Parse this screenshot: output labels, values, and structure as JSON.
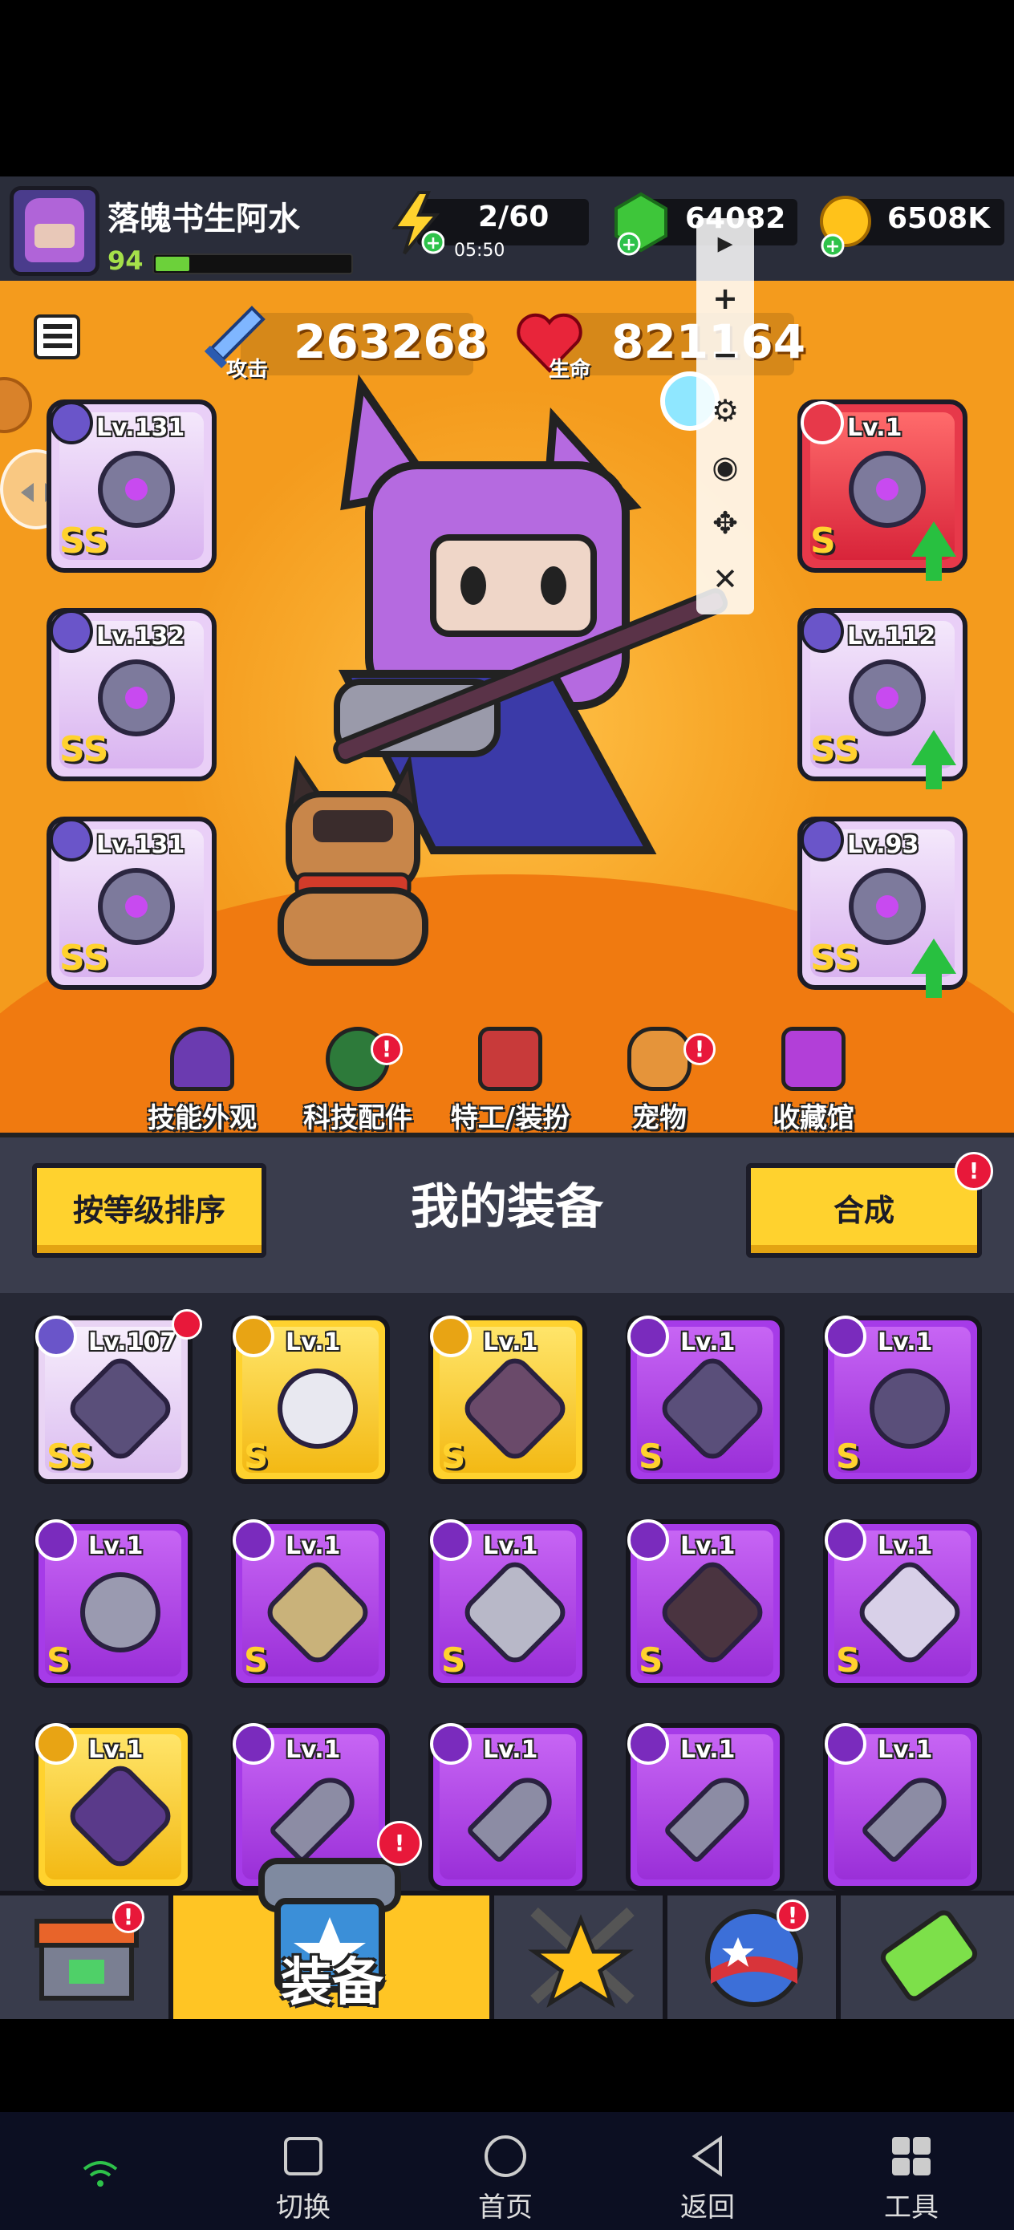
{
  "player": {
    "name": "落魄书生阿水",
    "level": "94"
  },
  "resources": {
    "energy": "2/60",
    "energy_timer": "05:50",
    "gems": "64082",
    "coins": "6508K"
  },
  "stats": {
    "attack_value": "263268",
    "attack_label": "攻击",
    "hp_value": "821164",
    "hp_label": "生命"
  },
  "equipped": {
    "left": [
      {
        "level": "Lv.131",
        "grade": "SS"
      },
      {
        "level": "Lv.132",
        "grade": "SS"
      },
      {
        "level": "Lv.131",
        "grade": "SS"
      }
    ],
    "right": [
      {
        "level": "Lv.1",
        "grade": "S"
      },
      {
        "level": "Lv.112",
        "grade": "SS"
      },
      {
        "level": "Lv.93",
        "grade": "SS"
      }
    ]
  },
  "stage_nav": [
    {
      "label": "技能外观"
    },
    {
      "label": "科技配件",
      "badge": "!"
    },
    {
      "label": "特工/装扮"
    },
    {
      "label": "宠物",
      "badge": "!"
    },
    {
      "label": "收藏馆"
    }
  ],
  "equipment_panel": {
    "sort_button": "按等级排序",
    "title": "我的装备",
    "merge_button": "合成",
    "merge_badge": "!"
  },
  "inventory": [
    {
      "level": "Lv.107",
      "grade": "SS",
      "rarity": "white"
    },
    {
      "level": "Lv.1",
      "grade": "S",
      "rarity": "gold"
    },
    {
      "level": "Lv.1",
      "grade": "S",
      "rarity": "gold"
    },
    {
      "level": "Lv.1",
      "grade": "S",
      "rarity": "purple"
    },
    {
      "level": "Lv.1",
      "grade": "S",
      "rarity": "purple"
    },
    {
      "level": "Lv.1",
      "grade": "S",
      "rarity": "purple"
    },
    {
      "level": "Lv.1",
      "grade": "S",
      "rarity": "purple"
    },
    {
      "level": "Lv.1",
      "grade": "S",
      "rarity": "purple"
    },
    {
      "level": "Lv.1",
      "grade": "S",
      "rarity": "purple"
    },
    {
      "level": "Lv.1",
      "grade": "S",
      "rarity": "purple"
    },
    {
      "level": "Lv.1",
      "grade": "",
      "rarity": "gold"
    },
    {
      "level": "Lv.1",
      "grade": "",
      "rarity": "purple"
    },
    {
      "level": "Lv.1",
      "grade": "",
      "rarity": "purple"
    },
    {
      "level": "Lv.1",
      "grade": "",
      "rarity": "purple"
    },
    {
      "level": "Lv.1",
      "grade": "",
      "rarity": "purple"
    }
  ],
  "tabs": {
    "active_label": "装备",
    "badge": "!"
  },
  "system_nav": {
    "switch": "切换",
    "home": "首页",
    "back": "返回",
    "tools": "工具"
  },
  "colors": {
    "stage_orange": "#f49b1d",
    "panel_dark": "#262835",
    "accent_yellow": "#ffd22e",
    "purple_rarity": "#a63be8"
  }
}
